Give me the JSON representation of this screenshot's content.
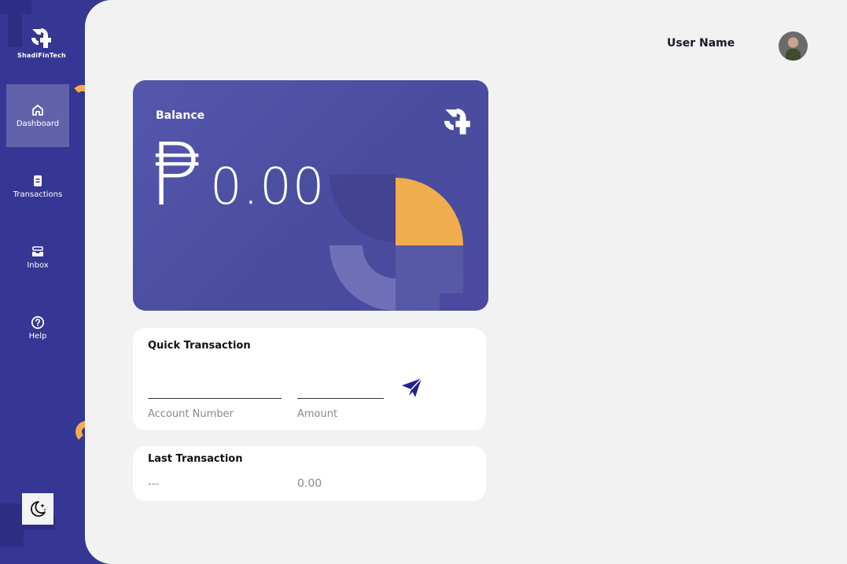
{
  "app": {
    "logo_text": "ShadiFinTech"
  },
  "sidebar": {
    "items": [
      {
        "label": "Dashboard",
        "icon": "home-icon",
        "active": true
      },
      {
        "label": "Transactions",
        "icon": "receipt-icon",
        "active": false
      },
      {
        "label": "Inbox",
        "icon": "inbox-icon",
        "active": false
      },
      {
        "label": "Help",
        "icon": "help-icon",
        "active": false
      }
    ],
    "theme_toggle_icon": "moon-stars-icon"
  },
  "header": {
    "user_name": "User Name"
  },
  "balance": {
    "title": "Balance",
    "currency_symbol": "₱",
    "amount": "0.00"
  },
  "quick_transaction": {
    "title": "Quick Transaction",
    "account_label": "Account Number",
    "amount_label": "Amount",
    "account_value": "",
    "amount_value": "",
    "send_icon": "send-icon"
  },
  "last_transaction": {
    "title": "Last Transaction",
    "name": "---",
    "amount": "0.00"
  },
  "colors": {
    "sidebar": "#363694",
    "card": "#4a4c9f",
    "accent": "#f0ad4e",
    "background": "#f2f2f2"
  }
}
